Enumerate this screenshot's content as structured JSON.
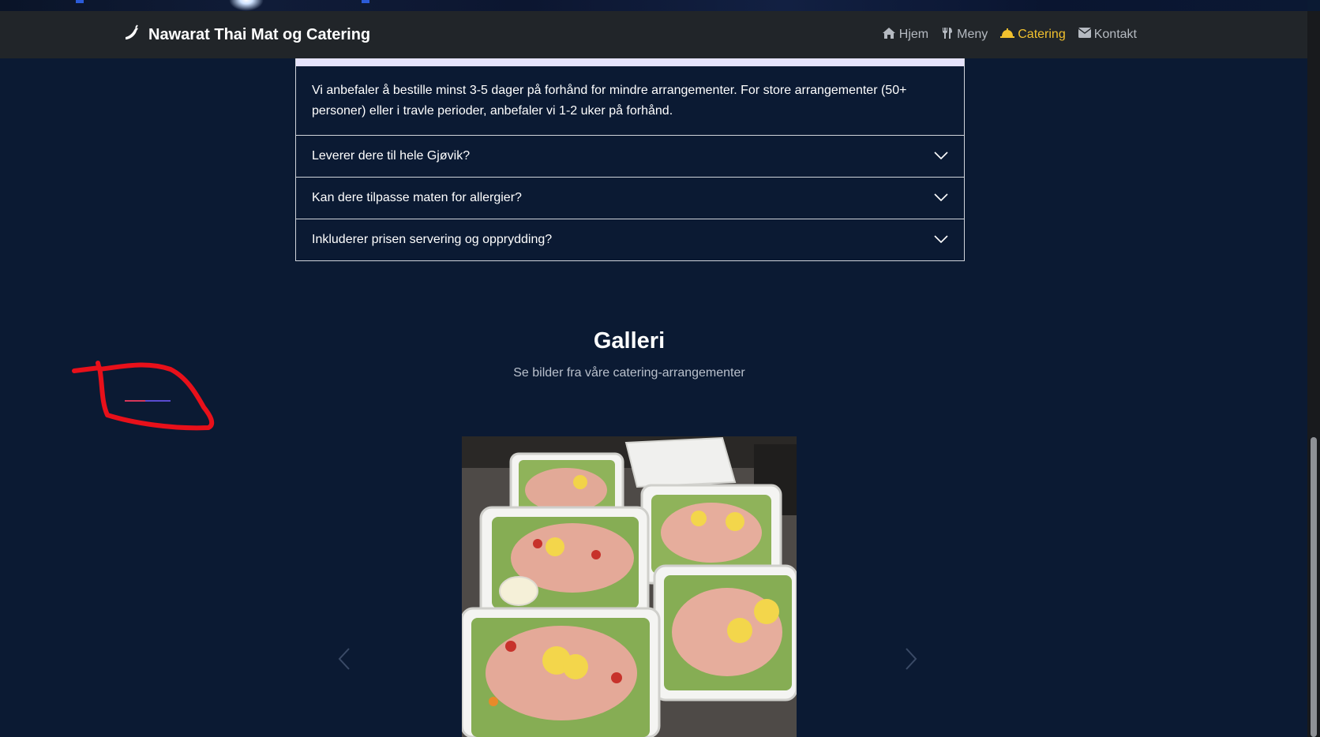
{
  "navbar": {
    "brand_icon": "chili-pepper-icon",
    "brand_title": "Nawarat Thai Mat og Catering",
    "links": [
      {
        "label": "Hjem",
        "icon": "home-icon",
        "active": false
      },
      {
        "label": "Meny",
        "icon": "utensils-icon",
        "active": false
      },
      {
        "label": "Catering",
        "icon": "cloche-icon",
        "active": true
      },
      {
        "label": "Kontakt",
        "icon": "envelope-icon",
        "active": false
      }
    ],
    "active_color": "#f2c12e"
  },
  "faq": {
    "open_answer": "Vi anbefaler å bestille minst 3-5 dager på forhånd for mindre arrangementer. For store arrangementer (50+ personer) eller i travle perioder, anbefaler vi 1-2 uker på forhånd.",
    "items": [
      {
        "question": "Leverer dere til hele Gjøvik?"
      },
      {
        "question": "Kan dere tilpasse maten for allergier?"
      },
      {
        "question": "Inkluderer prisen servering og opprydding?"
      }
    ]
  },
  "gallery": {
    "title": "Galleri",
    "subtitle": "Se bilder fra våre catering-arrangementer",
    "image_icon": "shrimp-salad-photo"
  },
  "colors": {
    "page_background": "#0b1a33",
    "navbar_background": "#212529",
    "annotation_red": "#e8101a"
  }
}
